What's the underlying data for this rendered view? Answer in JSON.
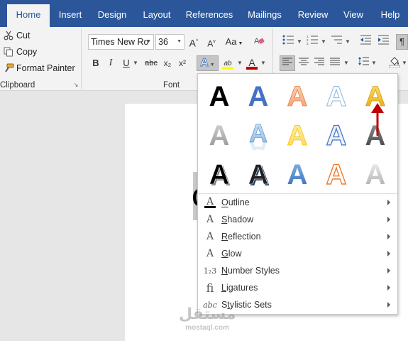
{
  "tabs": [
    {
      "label": "Home",
      "active": true
    },
    {
      "label": "Insert"
    },
    {
      "label": "Design"
    },
    {
      "label": "Layout"
    },
    {
      "label": "References"
    },
    {
      "label": "Mailings"
    },
    {
      "label": "Review"
    },
    {
      "label": "View"
    },
    {
      "label": "Help"
    }
  ],
  "clipboard": {
    "cut": "Cut",
    "copy": "Copy",
    "format_painter": "Format Painter",
    "group_label": "Clipboard"
  },
  "font": {
    "font_name": "Times New Ro",
    "font_size": "36",
    "grow": "A",
    "shrink": "A",
    "change_case": "Aa",
    "bold": "B",
    "italic": "I",
    "underline": "U",
    "strikethrough": "abc",
    "subscript": "x₂",
    "superscript": "x²",
    "text_effects": "A",
    "highlight": "ab",
    "font_color": "A",
    "group_label": "Font"
  },
  "document": {
    "partial_text": "c"
  },
  "effects_menu": {
    "items": [
      {
        "label": "Outline",
        "icon": "A",
        "accel": "O"
      },
      {
        "label": "Shadow",
        "icon": "A",
        "accel": "S"
      },
      {
        "label": "Reflection",
        "icon": "A",
        "accel": "R"
      },
      {
        "label": "Glow",
        "icon": "A",
        "accel": "G"
      },
      {
        "label": "Number Styles",
        "icon": "1₂3",
        "accel": "N"
      },
      {
        "label": "Ligatures",
        "icon": "fi",
        "accel": "L"
      },
      {
        "label": "Stylistic Sets",
        "icon": "abc",
        "accel": "T"
      }
    ]
  },
  "colors": {
    "ribbon_blue": "#2b579a",
    "annotation_red": "#c00000"
  },
  "watermark": {
    "arabic": "مستقل",
    "latin": "mostaql.com"
  }
}
